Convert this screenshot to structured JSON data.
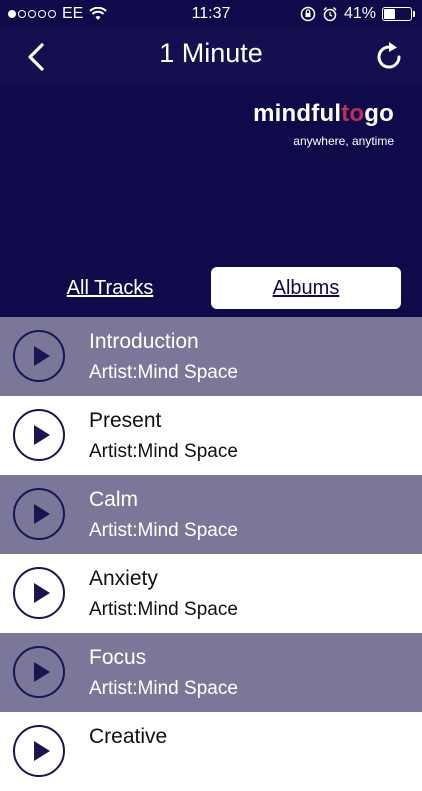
{
  "status": {
    "carrier": "EE",
    "time": "11:37",
    "battery": "41%",
    "signal_bars": 1
  },
  "nav": {
    "title": "1 Minute"
  },
  "logo": {
    "mindful": "mindful",
    "to": "to",
    "go": "go",
    "tagline": "anywhere, anytime"
  },
  "tabs": {
    "all_tracks": "All Tracks",
    "albums": "Albums"
  },
  "tracks": [
    {
      "title": "Introduction",
      "artist": "Artist:Mind Space"
    },
    {
      "title": "Present",
      "artist": "Artist:Mind Space"
    },
    {
      "title": "Calm",
      "artist": "Artist:Mind Space"
    },
    {
      "title": "Anxiety",
      "artist": "Artist:Mind Space"
    },
    {
      "title": "Focus",
      "artist": "Artist:Mind Space"
    },
    {
      "title": "Creative",
      "artist": ""
    }
  ],
  "colors": {
    "background": "#0f0b4a",
    "alt_row": "#7a7799",
    "accent": "#c32b5a"
  }
}
